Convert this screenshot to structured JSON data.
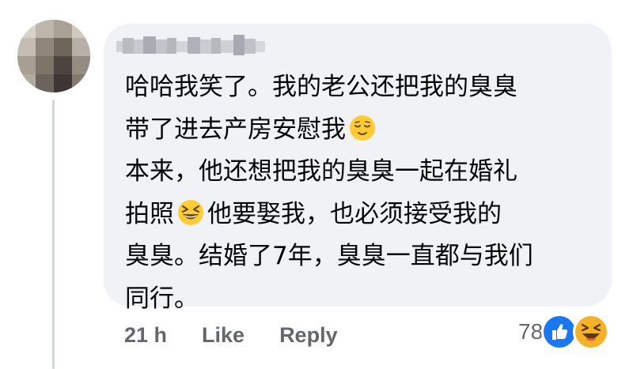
{
  "comment": {
    "author_name": "",
    "lines": [
      "哈哈我笑了。我的老公还把我的臭臭",
      "带了进去产房安慰我",
      "本来，他还想把我的臭臭一起在婚礼",
      "拍照",
      "他要娶我，也必须接受我的",
      "臭臭。结婚了7年，臭臭一直都与我们",
      "同行。"
    ],
    "emojis": [
      "relieved-face-emoji",
      "grinning-squinting-face-emoji"
    ]
  },
  "actions": {
    "time": "21 h",
    "like": "Like",
    "reply": "Reply"
  },
  "reactions": {
    "count": "78",
    "icons": [
      "like-reaction-icon",
      "haha-reaction-icon"
    ],
    "like_color": "#1877f2",
    "haha_color": "#f7b125"
  },
  "colors": {
    "bubble": "#f0f2f5",
    "text": "#050505",
    "secondary": "#65676b"
  }
}
